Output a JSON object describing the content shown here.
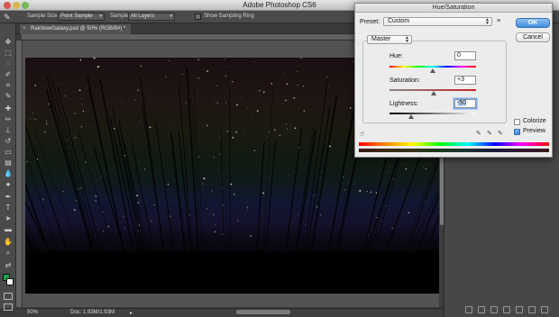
{
  "app": {
    "title": "Adobe Photoshop CS6"
  },
  "options_bar": {
    "sample_size_label": "Sample Size:",
    "sample_size_value": "Point Sample",
    "layers_label": "Sample:",
    "layers_value": "All Layers",
    "show_ring_label": "Show Sampling Ring"
  },
  "document": {
    "tab_label": "RainbowGalaxy.psd @ 50% (RGB/8#) *",
    "zoom": "50%",
    "doc_info": "Doc: 1.93M/1.93M"
  },
  "colors": {
    "foreground": "#1aa046",
    "background": "#ffffff",
    "accent": "#4a90e2"
  },
  "dialog": {
    "title": "Hue/Saturation",
    "preset_label": "Preset:",
    "preset_value": "Custom",
    "preset_menu_icon": "≡",
    "ok_label": "OK",
    "cancel_label": "Cancel",
    "channel_value": "Master",
    "hue_label": "Hue:",
    "hue_value": "0",
    "hue_level": 0.5,
    "saturation_label": "Saturation:",
    "saturation_value": "+3",
    "saturation_level": 0.515,
    "lightness_label": "Lightness:",
    "lightness_value": "-50",
    "lightness_level": 0.25,
    "colorize_label": "Colorize",
    "colorize_checked": false,
    "preview_label": "Preview",
    "preview_checked": true
  },
  "icons": {
    "tools": [
      "move-icon",
      "marquee-icon",
      "lasso-icon",
      "quick-select-icon",
      "crop-icon",
      "eyedropper-icon",
      "healing-icon",
      "brush-icon",
      "clone-stamp-icon",
      "history-brush-icon",
      "eraser-icon",
      "gradient-icon",
      "blur-icon",
      "dodge-icon",
      "pen-icon",
      "type-icon",
      "path-select-icon",
      "shape-icon",
      "hand-icon",
      "zoom-icon"
    ],
    "dialog": [
      "hand-icon",
      "eyedropper-icon",
      "eyedropper-plus-icon",
      "eyedropper-minus-icon"
    ]
  }
}
